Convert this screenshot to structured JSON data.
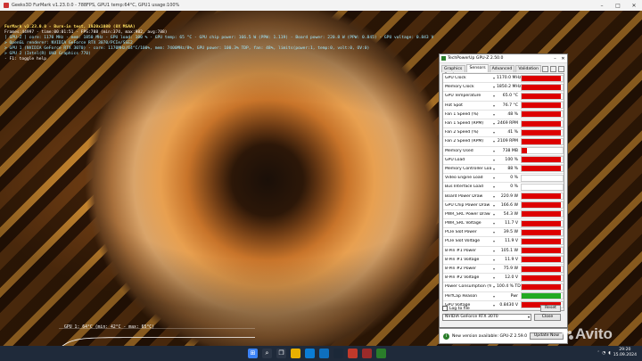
{
  "window": {
    "title": "Geeks3D FurMark v1.23.0.0 - 788FPS, GPU1 temp:64°C, GPU1 usage:100%"
  },
  "hud": {
    "line1": "FurMark v1.23.0.0 - Burn-in test, 1920x1080 (8X MSAA)",
    "line2": "Frames:44997 - time:00:01:51 - FPS:788 (min:374, max:982, avg:788)",
    "line3": "[ GPU-Z ] core: 1170 MHz - mem: 1850 MHz - GPU load: 100 % - GPU temp: 65 °C - GPU chip power: 166.5 W (PPW: 1.119) - Board power: 220.8 W (PPW: 0.845) - GPU voltage: 0.843 V",
    "line4": "> OpenGL renderer: NVIDIA GeForce RTX 3070/PCIe/SSE2",
    "line5": "> GPU 1 (NVIDIA GeForce RTX 3070) - core: 1170MHz/64°C/100%, mem: 7400MHz/8%, GPU power: 100.3% TDP, fan: 48%, limits(power:1, temp:0, volt:0, OV:0)",
    "line6": "> GPU 2 (Intel(R) UHD Graphics 770)",
    "line7": "- F1: toggle help"
  },
  "temp_graph": {
    "label": "GPU 1: 64°C (min: 42°C - max: 65°C)",
    "min_c": 42,
    "max_c": 65,
    "current_c": 64
  },
  "gpuz": {
    "title": "TechPowerUp GPU-Z 2.50.0",
    "tabs": [
      "Graphics Card",
      "Sensors",
      "Advanced",
      "Validation"
    ],
    "active_tab": "Sensors",
    "sensors": [
      {
        "name": "GPU Clock",
        "value": "1170.0 MHz",
        "fill": 0.95,
        "color": "#dd0000"
      },
      {
        "name": "Memory Clock",
        "value": "1850.2 MHz",
        "fill": 0.95,
        "color": "#dd0000"
      },
      {
        "name": "GPU Temperature",
        "value": "65.0 °C",
        "fill": 0.95,
        "color": "#dd0000"
      },
      {
        "name": "Hot Spot",
        "value": "76.7 °C",
        "fill": 0.95,
        "color": "#dd0000"
      },
      {
        "name": "Fan 1 Speed (%)",
        "value": "48 %",
        "fill": 0.95,
        "color": "#dd0000"
      },
      {
        "name": "Fan 1 Speed (RPM)",
        "value": "2469 RPM",
        "fill": 0.95,
        "color": "#dd0000"
      },
      {
        "name": "Fan 2 Speed (%)",
        "value": "41 %",
        "fill": 0.95,
        "color": "#dd0000"
      },
      {
        "name": "Fan 2 Speed (RPM)",
        "value": "2109 RPM",
        "fill": 0.95,
        "color": "#dd0000"
      },
      {
        "name": "Memory Used",
        "value": "738 MB",
        "fill": 0.12,
        "color": "#dd0000"
      },
      {
        "name": "GPU Load",
        "value": "100 %",
        "fill": 0.95,
        "color": "#dd0000"
      },
      {
        "name": "Memory Controller Load",
        "value": "88 %",
        "fill": 0.95,
        "color": "#dd0000"
      },
      {
        "name": "Video Engine Load",
        "value": "0 %",
        "fill": 0,
        "color": "#dd0000"
      },
      {
        "name": "Bus Interface Load",
        "value": "0 %",
        "fill": 0,
        "color": "#dd0000"
      },
      {
        "name": "Board Power Draw",
        "value": "220.9 W",
        "fill": 0.95,
        "color": "#dd0000"
      },
      {
        "name": "GPU Chip Power Draw",
        "value": "166.6 W",
        "fill": 0.95,
        "color": "#dd0000"
      },
      {
        "name": "PWR_SRC Power Draw",
        "value": "54.3 W",
        "fill": 0.95,
        "color": "#dd0000"
      },
      {
        "name": "PWR_SRC Voltage",
        "value": "11.7 V",
        "fill": 0.95,
        "color": "#dd0000"
      },
      {
        "name": "PCIe Slot Power",
        "value": "39.5 W",
        "fill": 0.95,
        "color": "#dd0000"
      },
      {
        "name": "PCIe Slot Voltage",
        "value": "11.9 V",
        "fill": 0.95,
        "color": "#dd0000"
      },
      {
        "name": "8-Pin #1 Power",
        "value": "105.1 W",
        "fill": 0.95,
        "color": "#dd0000"
      },
      {
        "name": "8-Pin #1 Voltage",
        "value": "11.9 V",
        "fill": 0.95,
        "color": "#dd0000"
      },
      {
        "name": "8-Pin #2 Power",
        "value": "75.9 W",
        "fill": 0.95,
        "color": "#dd0000"
      },
      {
        "name": "8-Pin #2 Voltage",
        "value": "12.0 V",
        "fill": 0.95,
        "color": "#dd0000"
      },
      {
        "name": "Power Consumption (%)",
        "value": "100.4 % TDP",
        "fill": 0.95,
        "color": "#dd0000"
      },
      {
        "name": "PerfCap Reason",
        "value": "Pwr",
        "fill": 0.95,
        "color": "#22aa22"
      },
      {
        "name": "GPU Voltage",
        "value": "0.8430 V",
        "fill": 0.95,
        "color": "#dd0000"
      }
    ],
    "log_label": "Log to file",
    "reset_label": "Reset",
    "device": "NVIDIA GeForce RTX 3070",
    "close_label": "Close"
  },
  "notification": {
    "text": "New version available: GPU-Z 2.59.0",
    "button": "Update Now"
  },
  "watermark": "Avito",
  "taskbar": {
    "time": "29:20",
    "date": "15.09.2024"
  }
}
